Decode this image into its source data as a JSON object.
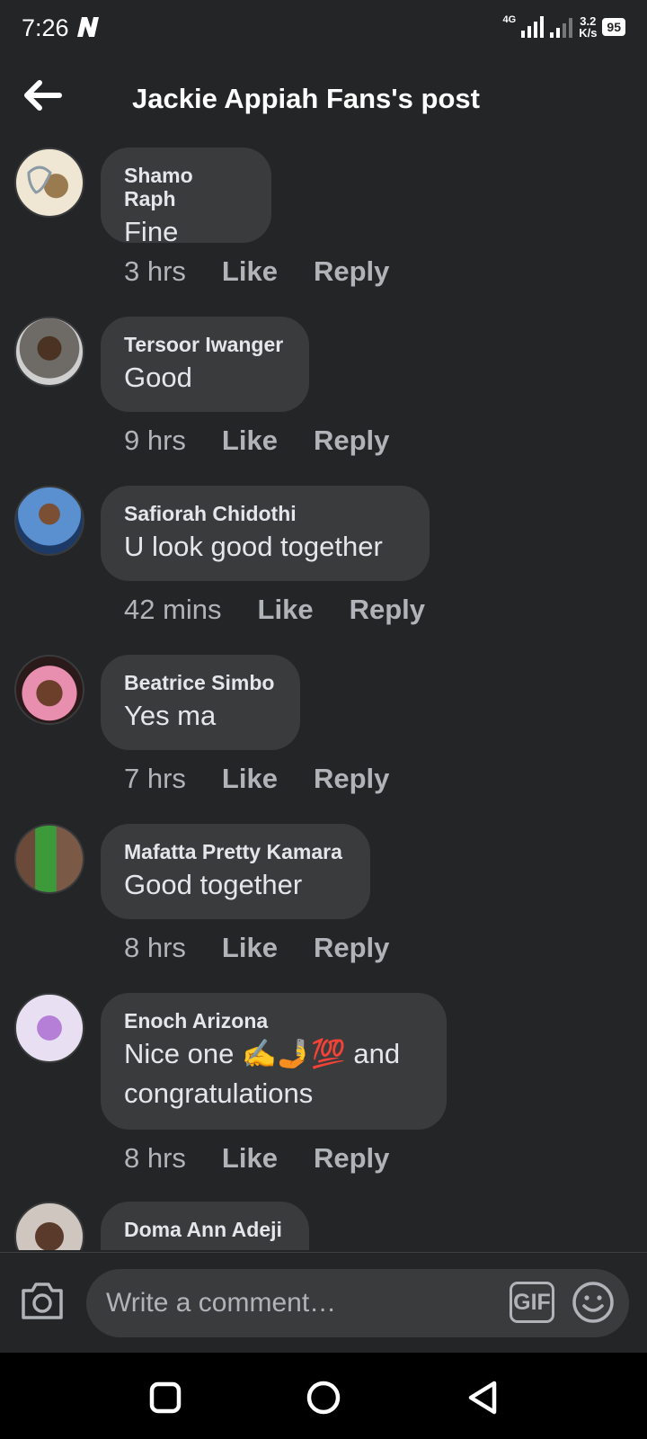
{
  "status_bar": {
    "time": "7:26",
    "network": "4G",
    "speed_value": "3.2",
    "speed_unit": "K/s",
    "battery": "95"
  },
  "header": {
    "title": "Jackie Appiah Fans's post",
    "back_icon": "arrow-left-icon"
  },
  "comments": [
    {
      "author": "Shamo Raph",
      "text": "Fine",
      "time": "3 hrs",
      "like": "Like",
      "reply": "Reply"
    },
    {
      "author": "Tersoor Iwanger",
      "text": "Good",
      "time": "9 hrs",
      "like": "Like",
      "reply": "Reply"
    },
    {
      "author": "Safiorah Chidothi",
      "text": "U look good together",
      "time": "42 mins",
      "like": "Like",
      "reply": "Reply"
    },
    {
      "author": "Beatrice Simbo",
      "text": "Yes ma",
      "time": "7 hrs",
      "like": "Like",
      "reply": "Reply"
    },
    {
      "author": "Mafatta Pretty Kamara",
      "text": "Good together",
      "time": "8 hrs",
      "like": "Like",
      "reply": "Reply"
    },
    {
      "author": "Enoch Arizona",
      "text_line1": "Nice one ✍️🤳💯 and",
      "text_line2": "congratulations",
      "time": "8 hrs",
      "like": "Like",
      "reply": "Reply"
    },
    {
      "author": "Doma Ann Adeji"
    }
  ],
  "composer": {
    "placeholder": "Write a comment…",
    "gif_label": "GIF",
    "camera_icon": "camera-icon",
    "emoji_icon": "smiley-icon"
  },
  "nav": {
    "recents_icon": "square-icon",
    "home_icon": "circle-icon",
    "back_icon": "triangle-back-icon"
  },
  "colors": {
    "background": "#242527",
    "bubble": "#3a3b3d",
    "text": "#e4e6eb",
    "secondary_text": "#b0b3b8"
  }
}
